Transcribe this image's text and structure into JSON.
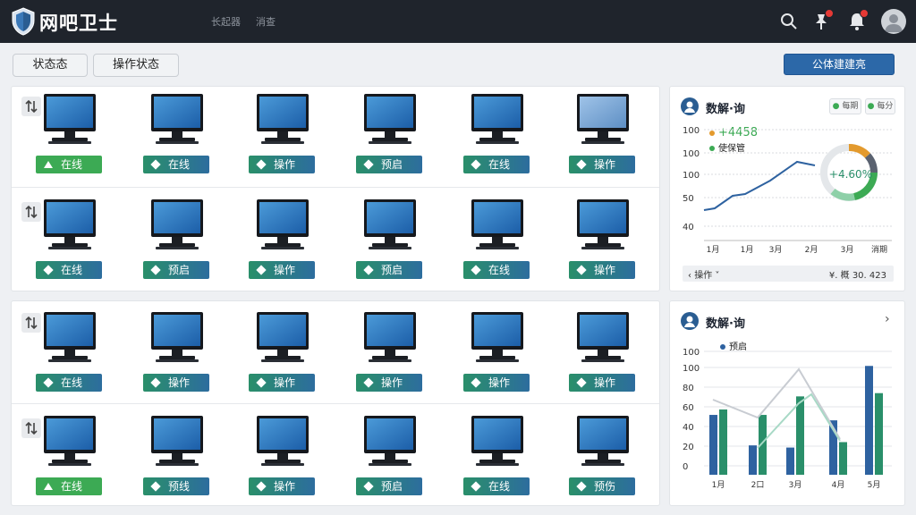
{
  "header": {
    "title": "网吧卫士",
    "nav": [
      "长起器",
      "消查"
    ],
    "icons": [
      "search-icon",
      "pin-icon",
      "bell-icon"
    ]
  },
  "tabs": [
    "状态态",
    "操作状态"
  ],
  "action_button": "公体建建亮",
  "machines_rows": [
    [
      "在线",
      "在线",
      "操作",
      "预启",
      "在线",
      "操作"
    ],
    [
      "在线",
      "预启",
      "操作",
      "预启",
      "在线",
      "操作"
    ],
    [
      "在线",
      "操作",
      "操作",
      "操作",
      "操作",
      "操作"
    ],
    [
      "在线",
      "预线",
      "操作",
      "预启",
      "在线",
      "预伤"
    ]
  ],
  "status_styles": [
    [
      "green",
      "teal",
      "teal",
      "teal",
      "teal",
      "teal"
    ],
    [
      "teal",
      "teal",
      "teal",
      "teal",
      "teal",
      "teal"
    ],
    [
      "teal",
      "teal",
      "teal",
      "teal",
      "teal",
      "teal"
    ],
    [
      "green",
      "teal",
      "teal",
      "teal",
      "teal",
      "teal"
    ]
  ],
  "colors": {
    "topbar": "#1f242c",
    "accent": "#2c68a8",
    "green": "#3caa54",
    "teal": "#2a8f6a"
  },
  "side_top": {
    "title": "数解·询",
    "buttons": [
      "每期",
      "每分"
    ],
    "legend": [
      {
        "label": "4458",
        "color": "#e39a2d"
      },
      {
        "label": "使保管",
        "color": "#3caa54"
      }
    ],
    "donut_value": "4.60%",
    "footer_left": "操作",
    "footer_right": "¥. 概   30. 423"
  },
  "side_bottom": {
    "title": "数解·询",
    "legend": "预启"
  },
  "chart_data": [
    {
      "type": "line",
      "x": [
        "1月",
        "1月",
        "3月",
        "2月",
        "3月",
        "消期"
      ],
      "yticks": [
        100,
        100,
        100,
        50,
        40
      ],
      "series": [
        {
          "values": [
            42,
            44,
            58,
            60,
            75,
            96,
            92
          ]
        }
      ],
      "title": "数解·询"
    },
    {
      "type": "bar",
      "categories": [
        "1月",
        "2口",
        "3月",
        "4月",
        "5月"
      ],
      "yticks": [
        100,
        100,
        80,
        60,
        40,
        20,
        0
      ],
      "series": [
        {
          "color": "#2e62a0",
          "values": [
            55,
            27,
            25,
            50,
            100
          ]
        },
        {
          "color": "#2a8f6a",
          "values": [
            60,
            55,
            72,
            30,
            75
          ]
        }
      ],
      "overlay_lines": true,
      "ylim": [
        0,
        115
      ]
    }
  ]
}
